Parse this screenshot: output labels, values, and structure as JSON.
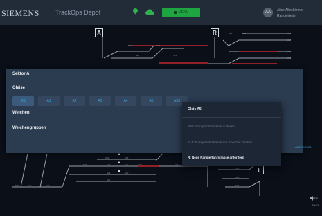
{
  "header": {
    "brand": "SIEMENS",
    "app_title": "TrackOps Depot",
    "menu_label": "MENU",
    "user_initials": "AA",
    "user_name": "Alice Alleskönner",
    "user_role": "Rangierleiter"
  },
  "track_map": {
    "sector_tags": [
      "A",
      "R",
      "F"
    ],
    "signal_labels": [
      "S11",
      "S12",
      "S13",
      "S14",
      "S15",
      "S16",
      "S17",
      "S18",
      "S19",
      "S20",
      "S21",
      "S22",
      "S23",
      "S24",
      "S25",
      "S26",
      "S27",
      "S28",
      "S29",
      "S30",
      "S31",
      "S32",
      "S33",
      "S34",
      "S35"
    ],
    "colors": {
      "track": "#9aa3ad",
      "occupied": "#c0262d",
      "label": "#7d8794",
      "background": "#0a0f18"
    }
  },
  "sector_panel": {
    "title": "Sektor A",
    "gleise_label": "Gleise",
    "gleise": [
      "905",
      "A1",
      "A2",
      "A3",
      "A4",
      "A5",
      "A33"
    ],
    "selected_gleis": "905",
    "weichen_label": "Weichen",
    "weichengruppen_label": "Weichengruppen",
    "cancel_label": "ABBRECHEN"
  },
  "context_menu": {
    "title": "Gleis A5",
    "items": [
      {
        "label": "RAF: Rangierfahrstrasse auflösen",
        "enabled": false
      },
      {
        "label": "SLR: Rangierfahrstrasse aus Speicher löschen",
        "enabled": false
      },
      {
        "label": "R: Neue Rangierfahrstrasse anfordern",
        "enabled": true
      }
    ]
  },
  "status": {
    "value_a": "15.6",
    "value_b": "2%",
    "value_c": "15"
  }
}
